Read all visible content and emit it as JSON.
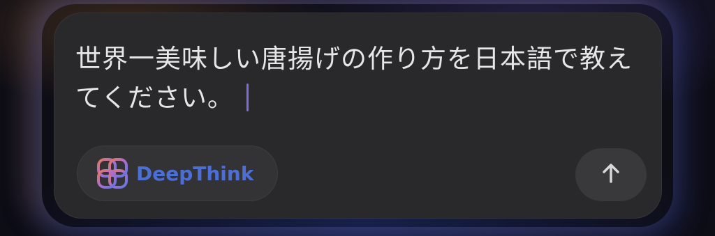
{
  "composer": {
    "prompt_text": "世界一美味しい唐揚げの作り方を日本語で教えてください。"
  },
  "deepthink": {
    "label": "DeepThink",
    "icon": "deepthink-knot-icon",
    "label_color": "#4c6fd6"
  },
  "send": {
    "icon": "arrow-up-icon"
  },
  "colors": {
    "panel_bg": "#29292b",
    "caret": "#7d6fd8"
  }
}
